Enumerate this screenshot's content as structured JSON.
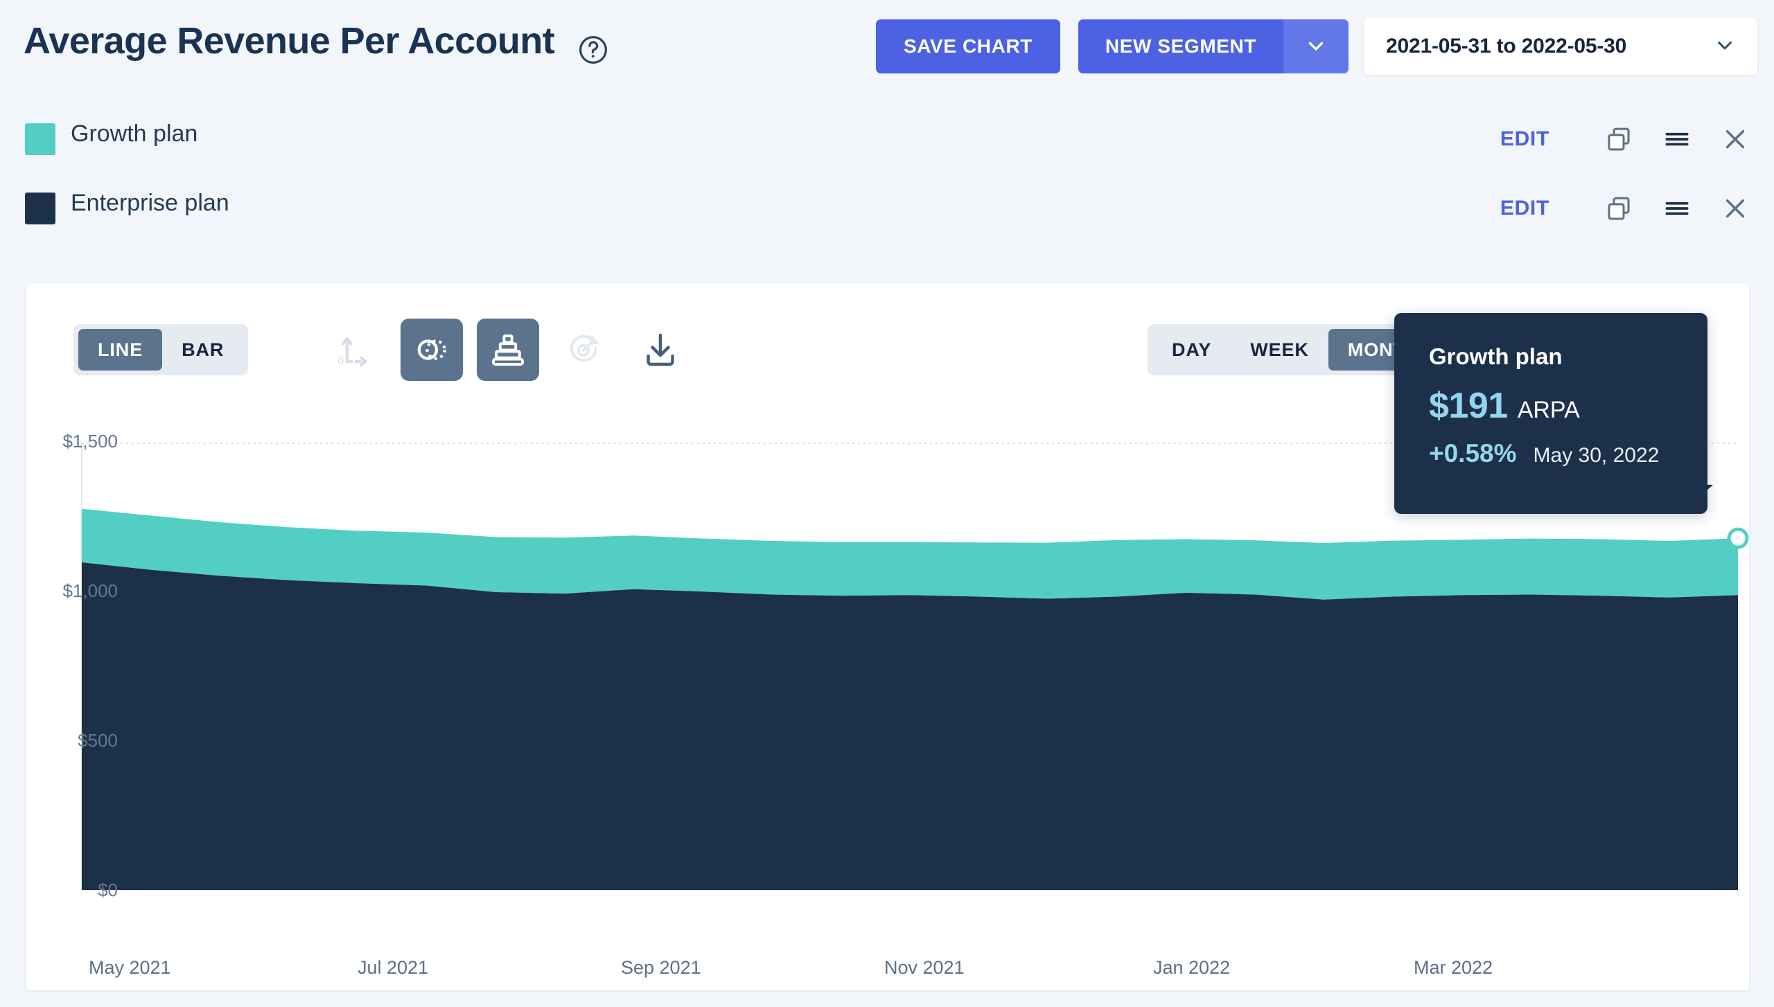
{
  "header": {
    "title": "Average Revenue Per Account",
    "help_icon": "question-circle-icon",
    "save_chart_label": "SAVE CHART",
    "new_segment_label": "NEW SEGMENT",
    "segment_caret_icon": "chevron-down-icon",
    "date_range": "2021-05-31 to 2022-05-30",
    "date_caret_icon": "chevron-down-icon",
    "primary_color": "#4C62E3",
    "primary_color_light": "#6277E8"
  },
  "legend": {
    "edit_label": "EDIT",
    "icons": [
      "duplicate-icon",
      "reorder-icon",
      "close-icon"
    ],
    "items": [
      {
        "label": "Growth plan",
        "color": "#52CFC2"
      },
      {
        "label": "Enterprise plan",
        "color": "#1D3049"
      }
    ]
  },
  "toolbar": {
    "chart_type": {
      "options": [
        "LINE",
        "BAR"
      ],
      "selected": "LINE"
    },
    "granularity": {
      "options": [
        "DAY",
        "WEEK",
        "MONTH"
      ],
      "selected": "MONTH"
    },
    "icons": [
      {
        "name": "axis-scale-icon",
        "state": "disabled"
      },
      {
        "name": "compare-overlap-icon",
        "state": "active"
      },
      {
        "name": "stacked-chart-icon",
        "state": "active"
      },
      {
        "name": "goal-target-icon",
        "state": "disabled"
      },
      {
        "name": "download-icon",
        "state": "default"
      }
    ]
  },
  "tooltip": {
    "title": "Growth plan",
    "value": "$191",
    "unit": "ARPA",
    "delta": "+0.58%",
    "date": "May 30, 2022",
    "background": "#1D3049",
    "accent": "#93D5EE"
  },
  "chart_data": {
    "type": "area",
    "title": "Average Revenue Per Account",
    "stacked": true,
    "xlabel": "",
    "ylabel": "",
    "ylim": [
      0,
      1500
    ],
    "y_ticks": [
      0,
      500,
      1000,
      1500
    ],
    "y_tick_labels": [
      "$0",
      "$500",
      "$1,000",
      "$1,500"
    ],
    "x_tick_labels": [
      "May 2021",
      "Jul 2021",
      "Sep 2021",
      "Nov 2021",
      "Jan 2022",
      "Mar 2022"
    ],
    "x": [
      "2021-05-31",
      "2021-06-15",
      "2021-06-30",
      "2021-07-15",
      "2021-07-31",
      "2021-08-15",
      "2021-08-31",
      "2021-09-15",
      "2021-09-30",
      "2021-10-15",
      "2021-10-31",
      "2021-11-15",
      "2021-11-30",
      "2021-12-15",
      "2021-12-31",
      "2022-01-15",
      "2022-01-31",
      "2022-02-15",
      "2022-02-28",
      "2022-03-15",
      "2022-03-31",
      "2022-04-15",
      "2022-04-30",
      "2022-05-15",
      "2022-05-30"
    ],
    "grid": false,
    "legend_position": "top-left",
    "series": [
      {
        "name": "Enterprise plan",
        "color": "#1D3049",
        "values": [
          1100,
          1075,
          1055,
          1040,
          1030,
          1022,
          1000,
          995,
          1010,
          1002,
          992,
          988,
          990,
          985,
          978,
          985,
          998,
          992,
          975,
          985,
          990,
          992,
          988,
          982,
          990
        ]
      },
      {
        "name": "Growth plan",
        "color": "#52CFC2",
        "values": [
          180,
          182,
          180,
          178,
          176,
          178,
          185,
          188,
          180,
          178,
          180,
          180,
          178,
          182,
          188,
          190,
          180,
          182,
          190,
          188,
          186,
          188,
          190,
          190,
          191
        ]
      }
    ],
    "hover_point": {
      "series": "Growth plan",
      "x": "2022-05-30",
      "value": 191,
      "stacked_total": 1181
    }
  }
}
